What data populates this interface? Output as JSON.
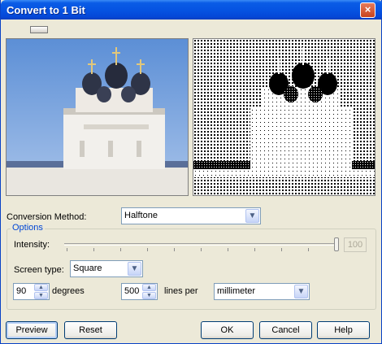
{
  "window": {
    "title": "Convert to 1 Bit",
    "close_glyph": "×"
  },
  "icons": {
    "close": "close-icon",
    "chevron": "chevron-down-icon",
    "up": "spin-up-icon",
    "down": "spin-down-icon"
  },
  "conversion": {
    "label": "Conversion Method:",
    "value": "Halftone"
  },
  "options": {
    "title": "Options",
    "intensity_label": "Intensity:",
    "intensity_value": "100",
    "screen_type_label": "Screen type:",
    "screen_type_value": "Square",
    "angle_value": "90",
    "angle_unit": "degrees",
    "frequency_value": "500",
    "frequency_unit": "lines per",
    "unit_value": "millimeter"
  },
  "buttons": {
    "preview": "Preview",
    "reset": "Reset",
    "ok": "OK",
    "cancel": "Cancel",
    "help": "Help"
  }
}
